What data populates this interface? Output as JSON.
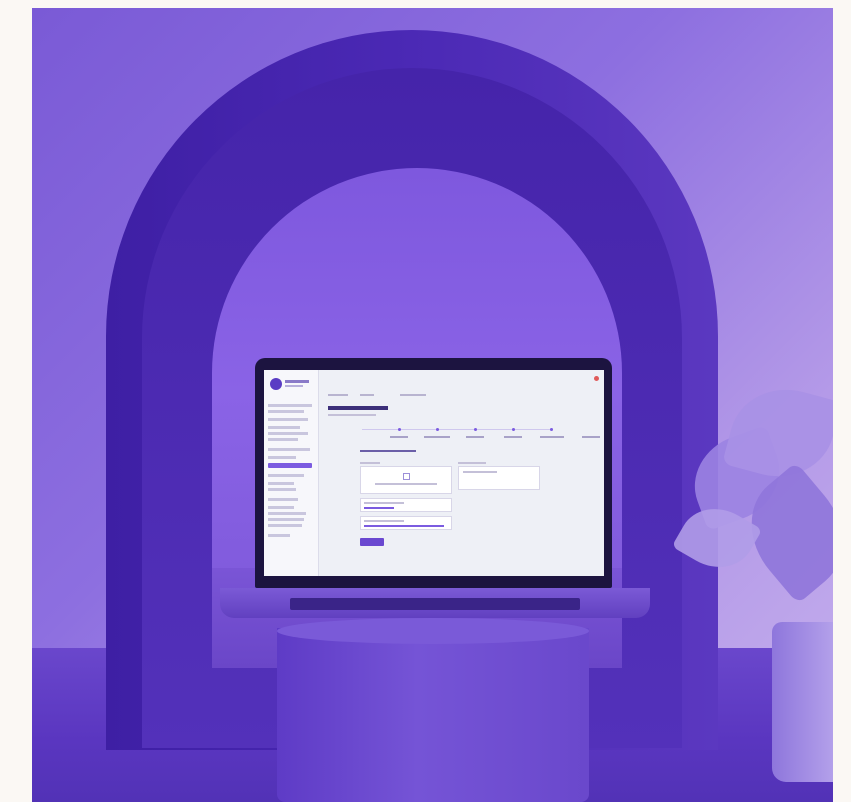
{
  "scene": {
    "description_tags": [
      "purple-arch",
      "laptop",
      "pedestal",
      "plant"
    ],
    "colors": {
      "background": "#fbf8f4",
      "arch": "#4b29b5",
      "accent": "#7b5be0",
      "screen": "#eef0f6"
    }
  }
}
